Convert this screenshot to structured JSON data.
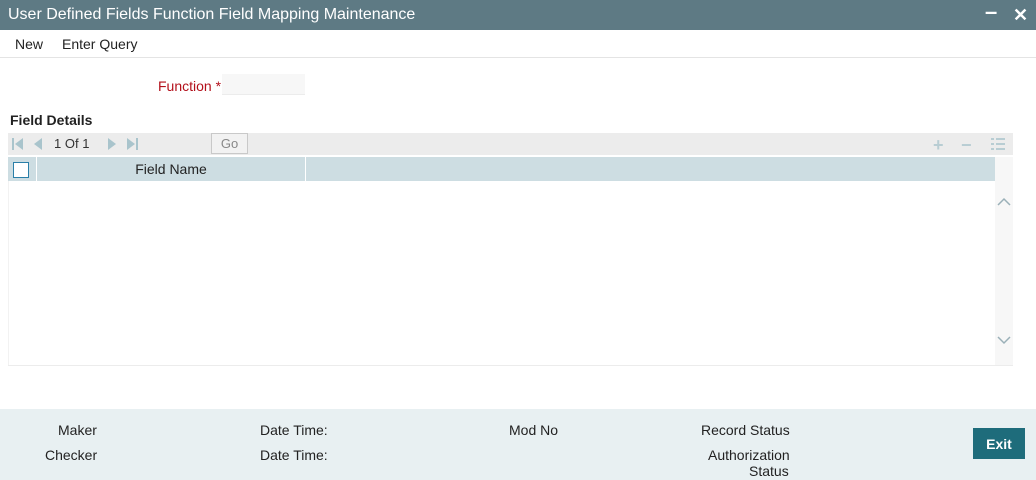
{
  "window": {
    "title": "User Defined Fields Function Field Mapping Maintenance",
    "minimize_glyph": "–",
    "close_glyph": "✕"
  },
  "menu": {
    "items": [
      {
        "label": "New"
      },
      {
        "label": "Enter Query"
      }
    ]
  },
  "form": {
    "function_label": "Function",
    "required_marker": "*",
    "function_value": ""
  },
  "field_details": {
    "section_title": "Field Details",
    "pager": {
      "current": "1",
      "of_label": "Of",
      "total": "1"
    },
    "go_label": "Go",
    "toolbar_icons": [
      "add-row-icon",
      "delete-row-icon",
      "list-icon"
    ],
    "columns": [
      {
        "label": "Field Name"
      }
    ],
    "rows": []
  },
  "footer": {
    "maker_label": "Maker",
    "checker_label": "Checker",
    "date_time_label_1": "Date Time:",
    "date_time_label_2": "Date Time:",
    "mod_no_label": "Mod No",
    "record_status_label": "Record Status",
    "authorization_status_label_line1": "Authorization",
    "authorization_status_label_line2": "Status",
    "exit_label": "Exit"
  },
  "colors": {
    "titlebar": "#5e7a84",
    "required_label": "#b3101b",
    "grid_header": "#cddde2",
    "footer_bg": "#e8f0f2",
    "exit_button": "#1e6c7b"
  }
}
